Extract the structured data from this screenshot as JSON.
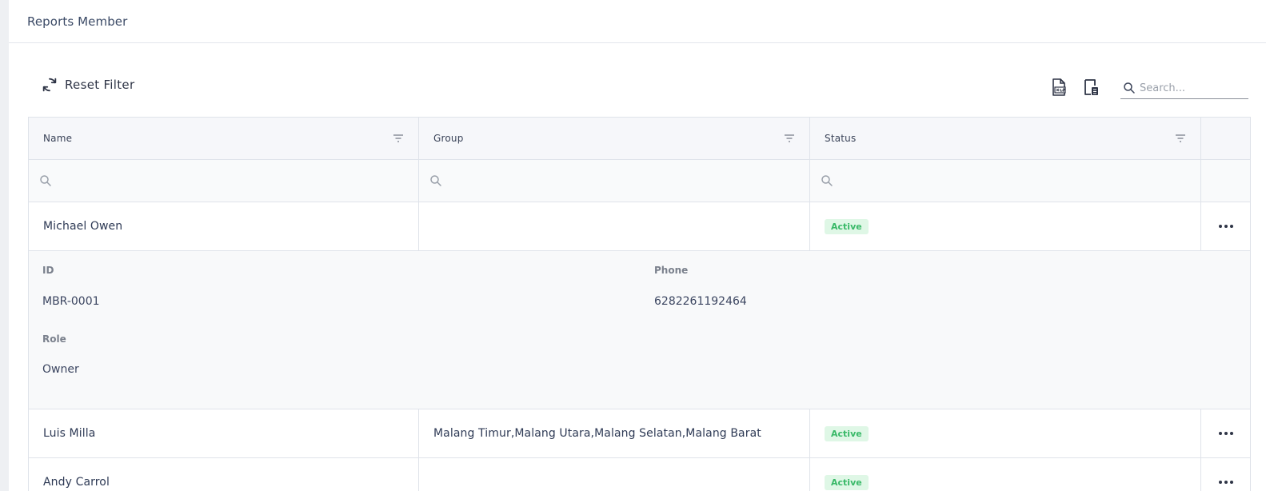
{
  "page": {
    "title": "Reports Member"
  },
  "toolbar": {
    "reset_label": "Reset Filter",
    "export_excel_icon": "file-excel-icon",
    "export_pdf_icon": "file-export-icon",
    "search_placeholder": "Search..."
  },
  "grid": {
    "columns": [
      {
        "label": "Name"
      },
      {
        "label": "Group"
      },
      {
        "label": "Status"
      }
    ],
    "rows": [
      {
        "name": "Michael Owen",
        "group": "",
        "status": "Active",
        "expanded": true,
        "detail": {
          "id_label": "ID",
          "id_value": "MBR-0001",
          "phone_label": "Phone",
          "phone_value": "6282261192464",
          "role_label": "Role",
          "role_value": "Owner"
        }
      },
      {
        "name": "Luis Milla",
        "group": "Malang Timur,Malang Utara,Malang Selatan,Malang Barat",
        "status": "Active"
      },
      {
        "name": "Andy Carrol",
        "group": "",
        "status": "Active"
      }
    ]
  },
  "colors": {
    "badge_bg": "#dff7e6",
    "badge_text": "#39b968",
    "header_bg": "#f6f7fa"
  }
}
